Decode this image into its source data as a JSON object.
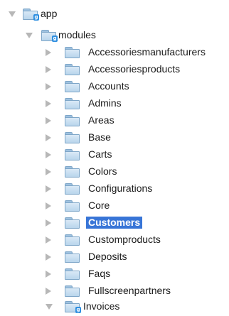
{
  "tree": {
    "root": {
      "label": "app"
    },
    "modules": {
      "label": "modules"
    },
    "items": [
      {
        "label": "Accessoriesmanufacturers"
      },
      {
        "label": "Accessoriesproducts"
      },
      {
        "label": "Accounts"
      },
      {
        "label": "Admins"
      },
      {
        "label": "Areas"
      },
      {
        "label": "Base"
      },
      {
        "label": "Carts"
      },
      {
        "label": "Colors"
      },
      {
        "label": "Configurations"
      },
      {
        "label": "Core"
      },
      {
        "label": "Customers",
        "selected": true
      },
      {
        "label": "Customproducts"
      },
      {
        "label": "Deposits"
      },
      {
        "label": "Faqs"
      },
      {
        "label": "Fullscreenpartners"
      }
    ],
    "invoices": {
      "label": "Invoices"
    }
  }
}
